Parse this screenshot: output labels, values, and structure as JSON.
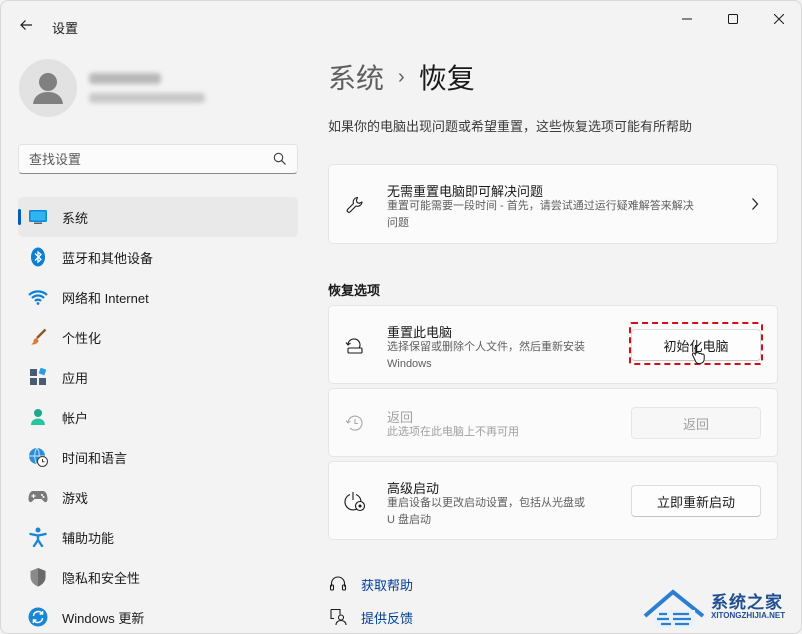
{
  "window": {
    "title": "设置",
    "controls": [
      "minimize-icon",
      "maximize-icon",
      "close-icon"
    ]
  },
  "sidebar": {
    "search": {
      "placeholder": "查找设置",
      "value": ""
    },
    "items": [
      {
        "label": "系统",
        "icon": "system-icon",
        "active": true
      },
      {
        "label": "蓝牙和其他设备",
        "icon": "bluetooth-icon"
      },
      {
        "label": "网络和 Internet",
        "icon": "wifi-icon"
      },
      {
        "label": "个性化",
        "icon": "brush-icon"
      },
      {
        "label": "应用",
        "icon": "apps-icon"
      },
      {
        "label": "帐户",
        "icon": "account-icon"
      },
      {
        "label": "时间和语言",
        "icon": "globe-clock-icon"
      },
      {
        "label": "游戏",
        "icon": "gamepad-icon"
      },
      {
        "label": "辅助功能",
        "icon": "accessibility-icon"
      },
      {
        "label": "隐私和安全性",
        "icon": "shield-icon"
      },
      {
        "label": "Windows 更新",
        "icon": "update-icon"
      }
    ]
  },
  "main": {
    "breadcrumb": {
      "parent": "系统",
      "separator": "›",
      "current": "恢复"
    },
    "description": "如果你的电脑出现问题或希望重置，这些恢复选项可能有所帮助",
    "fix_card": {
      "title": "无需重置电脑即可解决问题",
      "subtitle_line1": "重置可能需要一段时间 - 首先，请尝试通过运行疑难解答来解决",
      "subtitle_line2": "问题"
    },
    "section_title": "恢复选项",
    "reset_card": {
      "title": "重置此电脑",
      "subtitle_line1": "选择保留或删除个人文件，然后重新安装",
      "subtitle_line2": "Windows",
      "button": "初始化电脑"
    },
    "goback_card": {
      "title": "返回",
      "subtitle": "此选项在此电脑上不再可用",
      "button": "返回",
      "disabled": true
    },
    "advanced_card": {
      "title": "高级启动",
      "subtitle_line1": "重启设备以更改启动设置，包括从光盘或",
      "subtitle_line2": "U 盘启动",
      "button": "立即重新启动"
    },
    "links": [
      {
        "label": "获取帮助",
        "icon": "help-icon"
      },
      {
        "label": "提供反馈",
        "icon": "feedback-icon"
      }
    ]
  },
  "watermark": {
    "text": "系统之家",
    "sub": "XITONGZHIJIA.NET"
  },
  "colors": {
    "accent": "#005fb8",
    "highlight": "#d10f17",
    "link": "#003e92"
  }
}
